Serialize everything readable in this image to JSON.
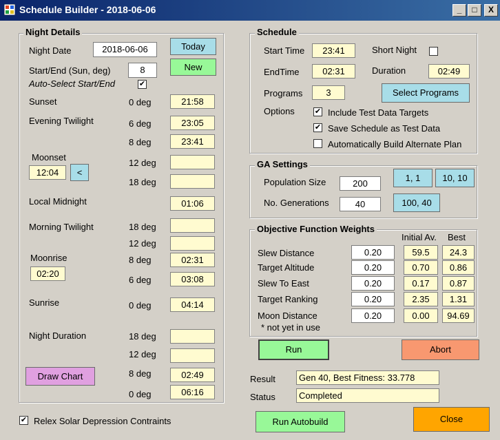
{
  "window": {
    "title": "Schedule Builder - 2018-06-06",
    "min_glyph": "_",
    "max_glyph": "□",
    "close_glyph": "X"
  },
  "night": {
    "title": "Night Details",
    "night_date_label": "Night Date",
    "night_date_value": "2018-06-06",
    "today_label": "Today",
    "start_end_label": "Start/End (Sun, deg)",
    "start_end_value": "8",
    "new_label": "New",
    "auto_select_label": "Auto-Select Start/End",
    "auto_select_mark": "✔",
    "sunset_label": "Sunset",
    "sunset_deg": "0 deg",
    "sunset_value": "21:58",
    "evening_label": "Evening Twilight",
    "ev_deg1": "6 deg",
    "ev_val1": "23:05",
    "ev_deg2": "8 deg",
    "ev_val2": "23:41",
    "moonset_label": "Moonset",
    "moonset_value": "12:04",
    "moonset_btn": "<",
    "ev_deg3": "12 deg",
    "ev_val3": "",
    "ev_deg4": "18 deg",
    "ev_val4": "",
    "midnight_label": "Local Midnight",
    "midnight_value": "01:06",
    "morning_label": "Morning Twilight",
    "mo_deg1": "18 deg",
    "mo_val1": "",
    "mo_deg2": "12 deg",
    "mo_val2": "",
    "moonrise_label": "Moonrise",
    "moonrise_value": "02:20",
    "mo_deg3": "8 deg",
    "mo_val3": "02:31",
    "mo_deg4": "6 deg",
    "mo_val4": "03:08",
    "sunrise_label": "Sunrise",
    "sunrise_deg": "0 deg",
    "sunrise_value": "04:14",
    "duration_label": "Night Duration",
    "du_deg1": "18 deg",
    "du_val1": "",
    "du_deg2": "12 deg",
    "du_val2": "",
    "du_deg3": "8 deg",
    "du_val3": "02:49",
    "du_deg4": "0 deg",
    "du_val4": "06:16",
    "draw_chart_label": "Draw Chart"
  },
  "relex_label": "Relex Solar Depression Contraints",
  "relex_mark": "✔",
  "schedule": {
    "title": "Schedule",
    "start_time_label": "Start Time",
    "start_time_value": "23:41",
    "short_night_label": "Short Night",
    "end_time_label": "EndTime",
    "end_time_value": "02:31",
    "duration_label": "Duration",
    "duration_value": "02:49",
    "programs_label": "Programs",
    "programs_value": "3",
    "select_programs_label": "Select Programs",
    "options_label": "Options",
    "opt1_label": "Include Test Data Targets",
    "opt1_mark": "✔",
    "opt2_label": "Save Schedule as Test Data",
    "opt2_mark": "✔",
    "opt3_label": "Automatically Build Alternate Plan"
  },
  "ga": {
    "title": "GA Settings",
    "pop_label": "Population Size",
    "pop_value": "200",
    "gen_label": "No. Generations",
    "gen_value": "40",
    "preset1": "1, 1",
    "preset2": "10, 10",
    "preset3": "100, 40"
  },
  "objective": {
    "title": "Objective Function Weights",
    "col_initial": "Initial Av.",
    "col_best": "Best",
    "rows": [
      {
        "label": "Slew Distance",
        "weight": "0.20",
        "initial": "59.5",
        "best": "24.3"
      },
      {
        "label": "Target Altitude",
        "weight": "0.20",
        "initial": "0.70",
        "best": "0.86"
      },
      {
        "label": "Slew To East",
        "weight": "0.20",
        "initial": "0.17",
        "best": "0.87"
      },
      {
        "label": "Target Ranking",
        "weight": "0.20",
        "initial": "2.35",
        "best": "1.31"
      },
      {
        "label": "Moon Distance",
        "weight": "0.20",
        "initial": "0.00",
        "best": "94.69"
      }
    ],
    "note": "* not yet in use"
  },
  "run_label": "Run",
  "abort_label": "Abort",
  "result_label": "Result",
  "result_value": "Gen 40, Best Fitness: 33.778",
  "status_label": "Status",
  "status_value": "Completed",
  "run_autobuild_label": "Run Autobuild",
  "close_label": "Close",
  "colors": {
    "field_bg": "#fffbd0",
    "btn_blue": "#a8dde8",
    "btn_green": "#98f898",
    "btn_pink": "#e0a0e0",
    "btn_salmon": "#f89870",
    "btn_orange": "#ffa500"
  }
}
